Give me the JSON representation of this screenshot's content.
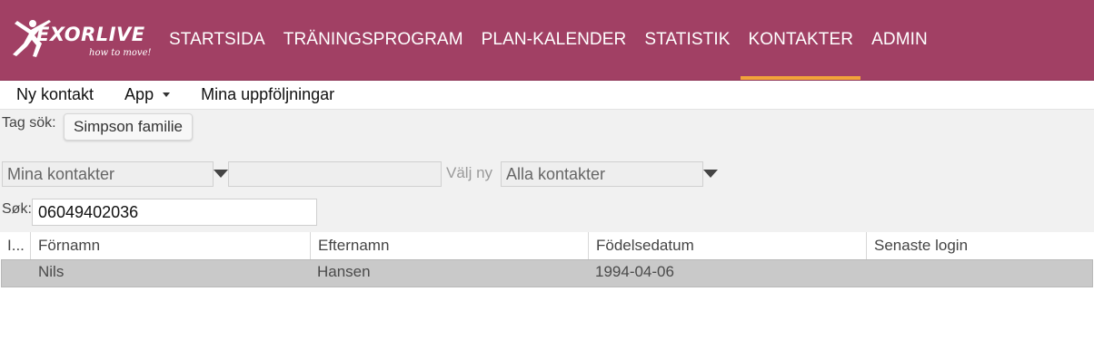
{
  "brand": {
    "name": "EXORLIVE",
    "tagline": "how to move!"
  },
  "nav": {
    "items": [
      {
        "label": "STARTSIDA"
      },
      {
        "label": "TRÄNINGSPROGRAM"
      },
      {
        "label": "PLAN-KALENDER"
      },
      {
        "label": "STATISTIK"
      },
      {
        "label": "KONTAKTER",
        "active": true
      },
      {
        "label": "ADMIN"
      }
    ],
    "accent_color": "#f2a33a",
    "bar_color": "#a14064"
  },
  "subnav": {
    "new_contact": "Ny kontakt",
    "app": "App",
    "followups": "Mina uppföljningar"
  },
  "filters": {
    "tag_label": "Tag sök:",
    "tag_chip": "Simpson familie",
    "contacts_select": "Mina kontakter",
    "middle_input": "",
    "choose_new_label": "Välj ny",
    "all_contacts_select": "Alla kontakter",
    "search_label": "Søk:",
    "search_value": "06049402036"
  },
  "table": {
    "columns": [
      "I...",
      "Förnamn",
      "Efternamn",
      "Födelsedatum",
      "Senaste login"
    ],
    "rows": [
      {
        "first": "Nils",
        "last": "Hansen",
        "birth": "1994-04-06",
        "last_login": ""
      }
    ]
  }
}
